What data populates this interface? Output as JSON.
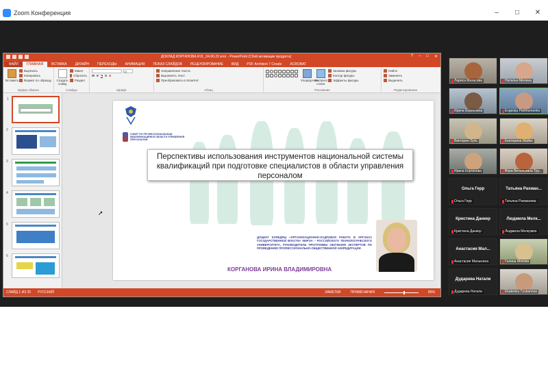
{
  "window": {
    "title": "Zoom Конференция",
    "controls": [
      "–",
      "□",
      "✕"
    ]
  },
  "ppt": {
    "doc_title": "ДОКЛАД КОРГАНОВА И.В._04.06.22 итог - PowerPoint (Сбой активации продукта)",
    "tabs": [
      "ФАЙЛ",
      "ГЛАВНАЯ",
      "ВСТАВКА",
      "ДИЗАЙН",
      "ПЕРЕХОДЫ",
      "АНИМАЦИЯ",
      "ПОКАЗ СЛАЙДОВ",
      "РЕЦЕНЗИРОВАНИЕ",
      "ВИД",
      "PDF Architect 7 Create",
      "ACROBAT"
    ],
    "ribbon": {
      "clipboard": {
        "paste": "Вставить",
        "cut": "Вырезать",
        "copy": "Копировать",
        "format": "Формат по образцу",
        "label": "Буфер обмена"
      },
      "slides": {
        "new": "Создать слайд",
        "layout": "Макет",
        "reset": "Сбросить",
        "section": "Раздел",
        "label": "Слайды"
      },
      "font": {
        "size": "12",
        "label": "Шрифт"
      },
      "paragraph": {
        "direction": "Направление текста",
        "align": "Выровнять текст",
        "smartart": "Преобразовать в SmartArt",
        "label": "Абзац"
      },
      "drawing": {
        "arrange": "Упорядочить",
        "styles": "Экспресс-стили",
        "fill": "Заливка фигуры",
        "outline": "Контур фигуры",
        "effects": "Эффекты фигуры",
        "label": "Рисование"
      },
      "editing": {
        "find": "Найти",
        "replace": "Заменить",
        "select": "Выделить",
        "label": "Редактирование"
      }
    },
    "slide": {
      "title": "Перспективы использования инструментов национальной системы квалификаций при подготовке специалистов в области управления персоналом",
      "council": "СОВЕТ ПО ПРОФЕССИОНАЛЬНЫМ КВАЛИФИКАЦИЯМ В ОБЛАСТИ УПРАВЛЕНИЯ ПЕРСОНАЛОМ",
      "speaker_role": "ДОЦЕНТ КАФЕДРЫ «ОРГАНИЗАЦИОННО-КАДРОВАЯ РАБОТА В ОРГАНАХ ГОСУДАРСТВЕННОЙ ВЛАСТИ» МИРЭА – РОССИЙСКОГО ТЕХНОЛОГИЧЕСКОГО УНИВЕРСИТЕТА, РУКОВОДИТЕЛЬ ПРОГРАММЫ ОБУЧЕНИЯ ЭКСПЕРТОВ ПО ПРОВЕДЕНИЮ ПРОФЕССИОНАЛЬНО-ОБЩЕСТВЕННОЙ АККРЕДИТАЦИИ",
      "speaker_name": "КОРГАНОВА ИРИНА ВЛАДИМИРОВНА"
    },
    "thumb_numbers": [
      "1",
      "2",
      "3",
      "4",
      "5",
      "6"
    ],
    "status": {
      "slide": "СЛАЙД 1 ИЗ 25",
      "lang": "РУССКИЙ",
      "notes": "ЗАМЕТКИ",
      "comments": "ПРИМЕЧАНИЯ",
      "zoom": "85%"
    }
  },
  "participants": [
    {
      "name": "Лариса Матасова",
      "video": true
    },
    {
      "name": "Наталья Мелина",
      "video": true
    },
    {
      "name": "Ирина Борисовна",
      "video": true
    },
    {
      "name": "Evgenija Parkhomenko",
      "video": true,
      "active": true
    },
    {
      "name": "Виктория Зуль",
      "video": true
    },
    {
      "name": "Екатерина Майко",
      "video": true
    },
    {
      "name": "Ирина Корганова",
      "video": true
    },
    {
      "name": "Вера Витальевна Тру...",
      "video": true
    },
    {
      "name": "Ольга Герр",
      "display": "Ольга Герр",
      "video": false
    },
    {
      "name": "Татьяна Рахманова",
      "display": "Татьяна Рахман...",
      "video": false
    },
    {
      "name": "Кристина Данкер",
      "display": "Кристина Данкер",
      "video": false
    },
    {
      "name": "Людмила Мелкумян",
      "display": "Людмила Мелк...",
      "video": false
    },
    {
      "name": "Анастасия Малыхина",
      "display": "Анастасия Мал...",
      "video": false
    },
    {
      "name": "Галина Мохова",
      "video": true
    },
    {
      "name": "Дударева Натали",
      "display": "Дударева Натали",
      "video": false
    },
    {
      "name": "Ekaterina Tzukanova",
      "video": true
    }
  ],
  "colors": {
    "ppt_accent": "#d24726",
    "zoom_bg": "#1e1e1e",
    "slide_title_text": "#222222",
    "speaker_name": "#7d3c98"
  }
}
